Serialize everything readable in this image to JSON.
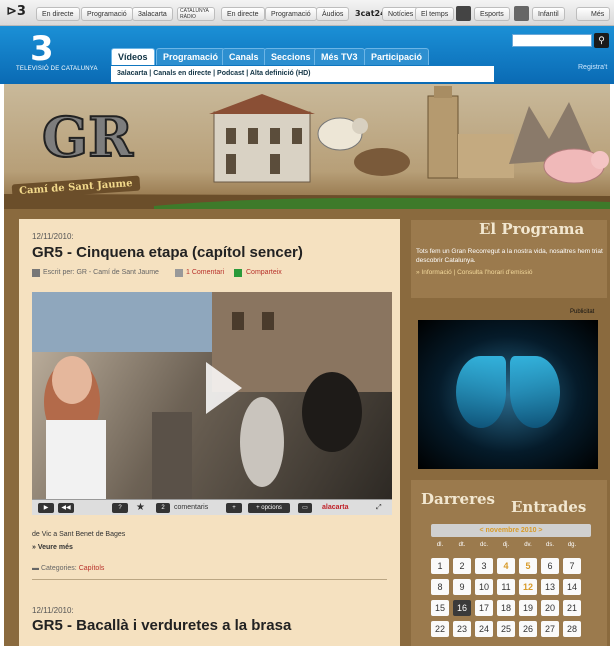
{
  "topbar": {
    "logo": "⊳3",
    "items": [
      "En directe",
      "Programació",
      "3alacarta",
      "En directe",
      "Programació",
      "Àudios",
      "Notícies",
      "El temps",
      "Esports",
      "Infantil",
      "Més"
    ],
    "radio_logo": "CATALUNYA RÀDIO",
    "logo_3cat24": "3cat24"
  },
  "header": {
    "logo": "3",
    "subtitle": "TELEVISIÓ DE CATALUNYA",
    "tabs": [
      "Vídeos",
      "Programació",
      "Canals",
      "Seccions",
      "Més TV3",
      "Participació"
    ],
    "subnav": "3alacarta | Canals en directe | Podcast | Alta definició (HD)",
    "register": "Registra't"
  },
  "banner": {
    "title": "Camí de Sant Jaume",
    "logo": "GR"
  },
  "post1": {
    "date": "12/11/2010:",
    "title": "GR5 - Cinquena etapa (capítol sencer)",
    "author": "Escrit per: GR - Camí de Sant Jaume",
    "comments": "1 Comentari",
    "share": "Comparteix",
    "excerpt": "de Vic a Sant Benet de Bages",
    "readmore": "» Veure més",
    "categories_label": "Categories:",
    "category": "Capítols"
  },
  "video_controls": {
    "comments_count": "2",
    "comments_label": "comentaris",
    "options_label": "+ opcions",
    "alacarta": "alacarta"
  },
  "post2": {
    "date": "12/11/2010:",
    "title": "GR5 - Bacallà i verduretes a la brasa"
  },
  "programa": {
    "heading": "El Programa",
    "text": "Tots fem un Gran Recorregut a la nostra vida, nosaltres hem triat descobrir Catalunya.",
    "links": "» Informació | Consulta l'horari d'emissió"
  },
  "ad": {
    "label": "Publicitat"
  },
  "entrades": {
    "heading1": "Darreres",
    "heading2": "Entrades",
    "month": "<  novembre 2010  >",
    "dow": [
      "dl.",
      "dt.",
      "dc.",
      "dj.",
      "dv.",
      "ds.",
      "dg."
    ],
    "rows": [
      [
        "1",
        "2",
        "3",
        "4",
        "5",
        "6",
        "7"
      ],
      [
        "8",
        "9",
        "10",
        "11",
        "12",
        "13",
        "14"
      ],
      [
        "15",
        "16",
        "17",
        "18",
        "19",
        "20",
        "21"
      ],
      [
        "22",
        "23",
        "24",
        "25",
        "26",
        "27",
        "28"
      ]
    ]
  },
  "colors": {
    "header_blue": "#0a6ab4",
    "post_bg": "#f5e1c0",
    "frame_brown": "#8a6a3e",
    "accent_red": "#b8322b"
  }
}
